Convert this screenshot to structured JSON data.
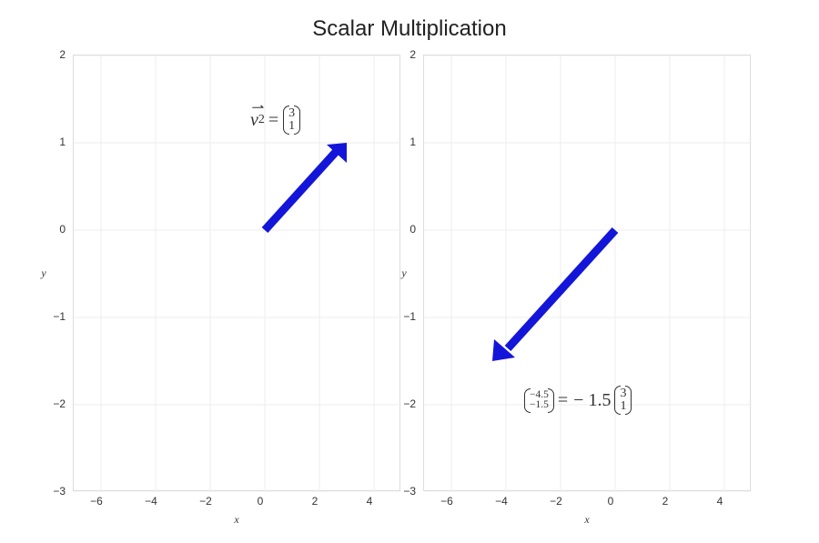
{
  "title": "Scalar Multiplication",
  "axes": {
    "xlabel": "x",
    "ylabel": "y",
    "xticks": [
      "−6",
      "−4",
      "−2",
      "0",
      "2",
      "4"
    ],
    "yticks": [
      "−3",
      "−2",
      "−1",
      "0",
      "1",
      "2"
    ]
  },
  "ann_left": {
    "var": "v",
    "sub": "2",
    "vec": [
      "3",
      "1"
    ]
  },
  "ann_right": {
    "result": [
      "−4.5",
      "−1.5"
    ],
    "scalar": "1.5",
    "vec": [
      "3",
      "1"
    ]
  },
  "chart_data": [
    {
      "type": "line",
      "title": "Scalar Multiplication",
      "xlabel": "x",
      "ylabel": "y",
      "xlim": [
        -7,
        5
      ],
      "ylim": [
        -3,
        2
      ],
      "series": [
        {
          "name": "v2",
          "x": [
            0,
            3
          ],
          "y": [
            0,
            1
          ],
          "color": "#1316d8"
        }
      ],
      "annotation": "v2 = (3, 1)"
    },
    {
      "type": "line",
      "title": "Scalar Multiplication",
      "xlabel": "x",
      "ylabel": "y",
      "xlim": [
        -7,
        5
      ],
      "ylim": [
        -3,
        2
      ],
      "series": [
        {
          "name": "-1.5 * v2",
          "x": [
            0,
            -4.5
          ],
          "y": [
            0,
            -1.5
          ],
          "color": "#1316d8"
        }
      ],
      "annotation": "(-4.5, -1.5) = -1.5 * (3, 1)"
    }
  ]
}
